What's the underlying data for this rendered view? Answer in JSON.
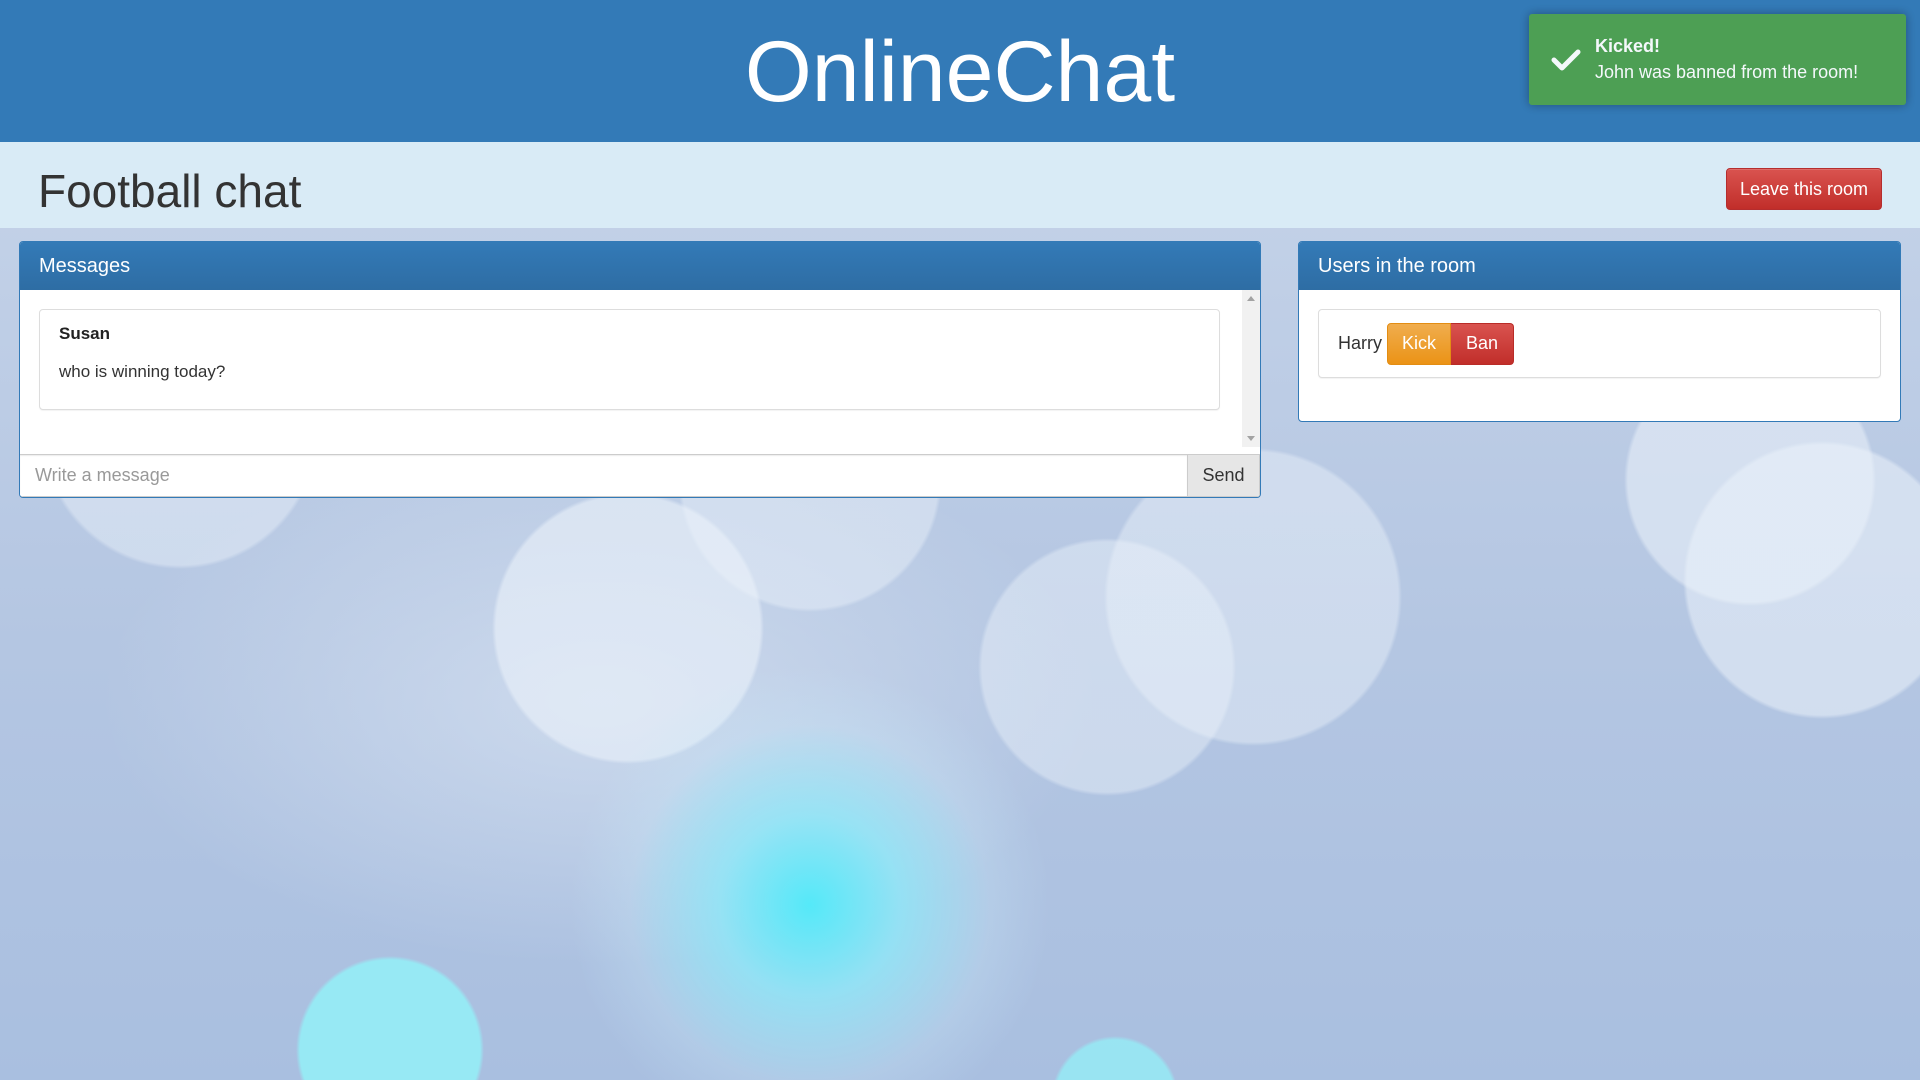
{
  "header": {
    "brand": "OnlineChat"
  },
  "toast": {
    "title": "Kicked!",
    "message": "John was banned from the room!",
    "icon": "check-icon",
    "color": "#4fa24f"
  },
  "room": {
    "title": "Football chat",
    "leave_label": "Leave this room"
  },
  "messages_panel": {
    "title": "Messages",
    "messages": [
      {
        "author": "Susan",
        "text": "who is winning today?"
      }
    ],
    "input_placeholder": "Write a message",
    "send_label": "Send"
  },
  "users_panel": {
    "title": "Users in the room",
    "users": [
      {
        "name": "Harry",
        "kick_label": "Kick",
        "ban_label": "Ban"
      }
    ]
  },
  "colors": {
    "primary": "#337ab7",
    "danger": "#d9534f",
    "warning": "#f0ad4e",
    "success": "#4fa24f",
    "room_bar": "#d9ebf6"
  }
}
